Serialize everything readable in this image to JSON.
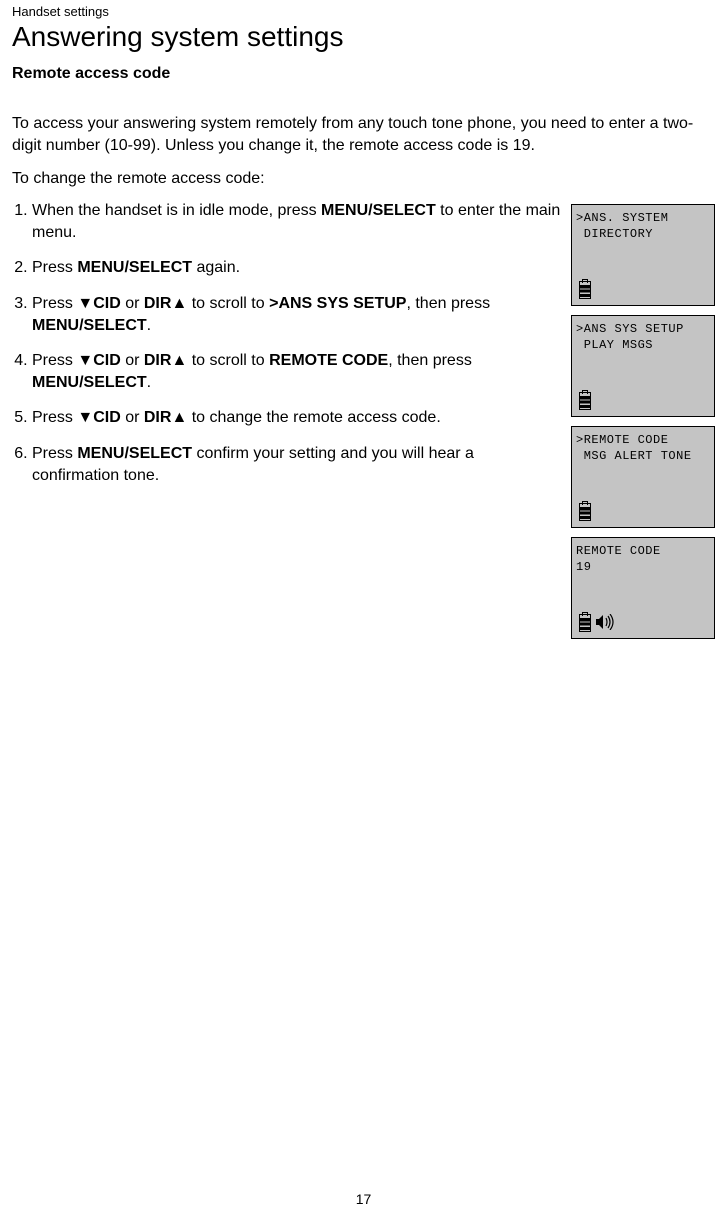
{
  "breadcrumb": "Handset settings",
  "title": "Answering system settings",
  "subtitle": "Remote access code",
  "intro": "To access your answering system remotely from any touch tone phone, you need to enter a two-digit number (10-99). Unless you change it, the remote access code is 19.",
  "changeLabel": "To change the remote access code:",
  "steps": {
    "s1a": "When the handset is in idle mode, press ",
    "s1b": "MENU/",
    "s1c": "SELECT",
    "s1d": " to enter the main menu.",
    "s2a": "Press ",
    "s2b": "MENU/",
    "s2c": "SELECT",
    "s2d": " again.",
    "s3a": "Press ",
    "s3cid": "CID",
    "s3or": " or ",
    "s3dir": "DIR",
    "s3mid": " to scroll to ",
    "s3target": ">ANS SYS SETUP",
    "s3then": ", then press ",
    "s3menu": "MENU",
    "s3select": "/SELECT",
    "s3end": ".",
    "s4a": "Press ",
    "s4cid": "CID",
    "s4or": " or ",
    "s4dir": "DIR",
    "s4mid": " to scroll to ",
    "s4target": "REMOTE CODE",
    "s4then": ", then press ",
    "s4menu": "MENU",
    "s4select": "/SELECT",
    "s4end": ".",
    "s5a": "Press ",
    "s5cid": "CID",
    "s5or": " or ",
    "s5dir": "DIR",
    "s5end": " to change the remote access code.",
    "s6a": "Press ",
    "s6menu": "MENU",
    "s6select": "/SELECT",
    "s6end": " confirm your setting and you will hear a confirmation tone."
  },
  "lcd": [
    {
      "line1": ">ANS. SYSTEM",
      "line2": " DIRECTORY",
      "speaker": false
    },
    {
      "line1": ">ANS SYS SETUP",
      "line2": " PLAY MSGS",
      "speaker": false
    },
    {
      "line1": ">REMOTE CODE",
      "line2": " MSG ALERT TONE",
      "speaker": false
    },
    {
      "line1": "REMOTE CODE",
      "line2": "19",
      "speaker": true
    }
  ],
  "triDown": "▼",
  "triUp": "▲",
  "pageNumber": "17"
}
